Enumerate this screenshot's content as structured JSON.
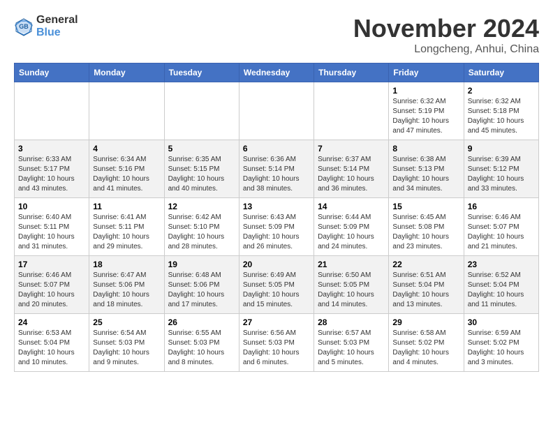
{
  "header": {
    "logo_line1": "General",
    "logo_line2": "Blue",
    "month_title": "November 2024",
    "location": "Longcheng, Anhui, China"
  },
  "weekdays": [
    "Sunday",
    "Monday",
    "Tuesday",
    "Wednesday",
    "Thursday",
    "Friday",
    "Saturday"
  ],
  "weeks": [
    [
      {
        "day": "",
        "info": ""
      },
      {
        "day": "",
        "info": ""
      },
      {
        "day": "",
        "info": ""
      },
      {
        "day": "",
        "info": ""
      },
      {
        "day": "",
        "info": ""
      },
      {
        "day": "1",
        "info": "Sunrise: 6:32 AM\nSunset: 5:19 PM\nDaylight: 10 hours\nand 47 minutes."
      },
      {
        "day": "2",
        "info": "Sunrise: 6:32 AM\nSunset: 5:18 PM\nDaylight: 10 hours\nand 45 minutes."
      }
    ],
    [
      {
        "day": "3",
        "info": "Sunrise: 6:33 AM\nSunset: 5:17 PM\nDaylight: 10 hours\nand 43 minutes."
      },
      {
        "day": "4",
        "info": "Sunrise: 6:34 AM\nSunset: 5:16 PM\nDaylight: 10 hours\nand 41 minutes."
      },
      {
        "day": "5",
        "info": "Sunrise: 6:35 AM\nSunset: 5:15 PM\nDaylight: 10 hours\nand 40 minutes."
      },
      {
        "day": "6",
        "info": "Sunrise: 6:36 AM\nSunset: 5:14 PM\nDaylight: 10 hours\nand 38 minutes."
      },
      {
        "day": "7",
        "info": "Sunrise: 6:37 AM\nSunset: 5:14 PM\nDaylight: 10 hours\nand 36 minutes."
      },
      {
        "day": "8",
        "info": "Sunrise: 6:38 AM\nSunset: 5:13 PM\nDaylight: 10 hours\nand 34 minutes."
      },
      {
        "day": "9",
        "info": "Sunrise: 6:39 AM\nSunset: 5:12 PM\nDaylight: 10 hours\nand 33 minutes."
      }
    ],
    [
      {
        "day": "10",
        "info": "Sunrise: 6:40 AM\nSunset: 5:11 PM\nDaylight: 10 hours\nand 31 minutes."
      },
      {
        "day": "11",
        "info": "Sunrise: 6:41 AM\nSunset: 5:11 PM\nDaylight: 10 hours\nand 29 minutes."
      },
      {
        "day": "12",
        "info": "Sunrise: 6:42 AM\nSunset: 5:10 PM\nDaylight: 10 hours\nand 28 minutes."
      },
      {
        "day": "13",
        "info": "Sunrise: 6:43 AM\nSunset: 5:09 PM\nDaylight: 10 hours\nand 26 minutes."
      },
      {
        "day": "14",
        "info": "Sunrise: 6:44 AM\nSunset: 5:09 PM\nDaylight: 10 hours\nand 24 minutes."
      },
      {
        "day": "15",
        "info": "Sunrise: 6:45 AM\nSunset: 5:08 PM\nDaylight: 10 hours\nand 23 minutes."
      },
      {
        "day": "16",
        "info": "Sunrise: 6:46 AM\nSunset: 5:07 PM\nDaylight: 10 hours\nand 21 minutes."
      }
    ],
    [
      {
        "day": "17",
        "info": "Sunrise: 6:46 AM\nSunset: 5:07 PM\nDaylight: 10 hours\nand 20 minutes."
      },
      {
        "day": "18",
        "info": "Sunrise: 6:47 AM\nSunset: 5:06 PM\nDaylight: 10 hours\nand 18 minutes."
      },
      {
        "day": "19",
        "info": "Sunrise: 6:48 AM\nSunset: 5:06 PM\nDaylight: 10 hours\nand 17 minutes."
      },
      {
        "day": "20",
        "info": "Sunrise: 6:49 AM\nSunset: 5:05 PM\nDaylight: 10 hours\nand 15 minutes."
      },
      {
        "day": "21",
        "info": "Sunrise: 6:50 AM\nSunset: 5:05 PM\nDaylight: 10 hours\nand 14 minutes."
      },
      {
        "day": "22",
        "info": "Sunrise: 6:51 AM\nSunset: 5:04 PM\nDaylight: 10 hours\nand 13 minutes."
      },
      {
        "day": "23",
        "info": "Sunrise: 6:52 AM\nSunset: 5:04 PM\nDaylight: 10 hours\nand 11 minutes."
      }
    ],
    [
      {
        "day": "24",
        "info": "Sunrise: 6:53 AM\nSunset: 5:04 PM\nDaylight: 10 hours\nand 10 minutes."
      },
      {
        "day": "25",
        "info": "Sunrise: 6:54 AM\nSunset: 5:03 PM\nDaylight: 10 hours\nand 9 minutes."
      },
      {
        "day": "26",
        "info": "Sunrise: 6:55 AM\nSunset: 5:03 PM\nDaylight: 10 hours\nand 8 minutes."
      },
      {
        "day": "27",
        "info": "Sunrise: 6:56 AM\nSunset: 5:03 PM\nDaylight: 10 hours\nand 6 minutes."
      },
      {
        "day": "28",
        "info": "Sunrise: 6:57 AM\nSunset: 5:03 PM\nDaylight: 10 hours\nand 5 minutes."
      },
      {
        "day": "29",
        "info": "Sunrise: 6:58 AM\nSunset: 5:02 PM\nDaylight: 10 hours\nand 4 minutes."
      },
      {
        "day": "30",
        "info": "Sunrise: 6:59 AM\nSunset: 5:02 PM\nDaylight: 10 hours\nand 3 minutes."
      }
    ]
  ]
}
